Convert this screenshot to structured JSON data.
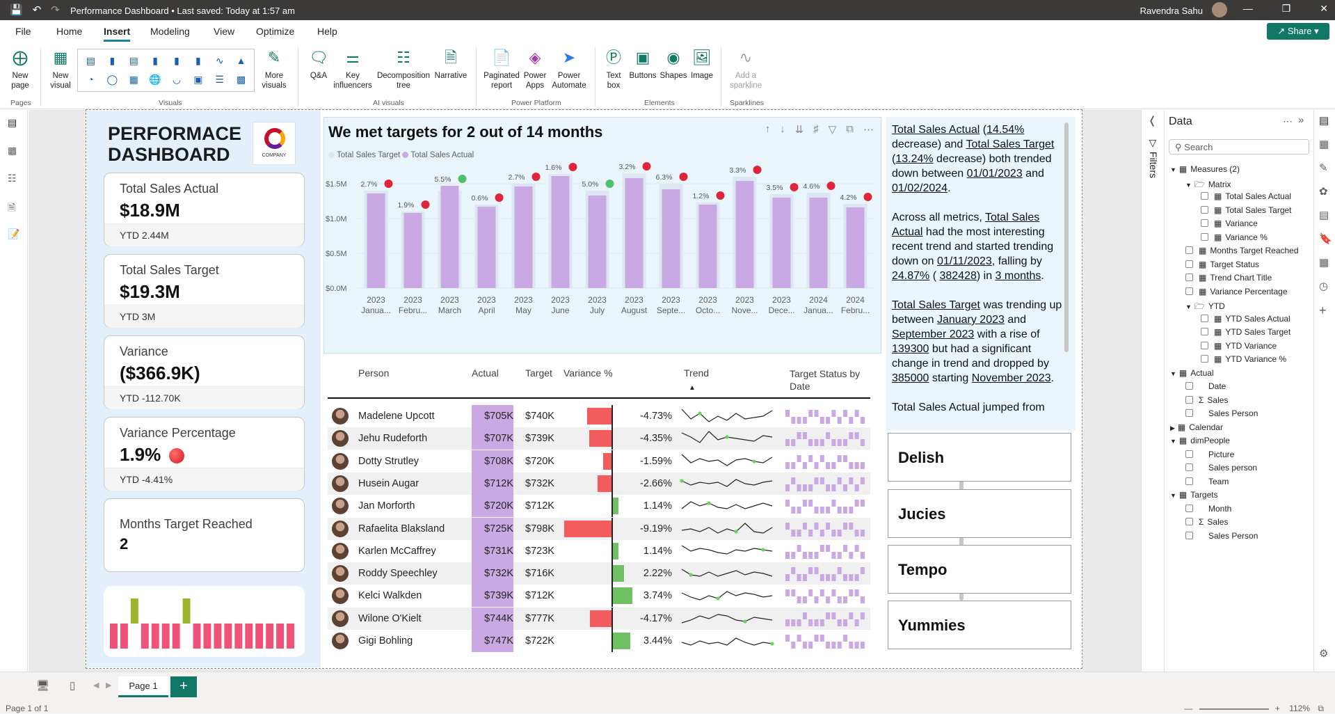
{
  "titlebar": {
    "doc_title": "Performance Dashboard • Last saved: Today at 1:57 am",
    "user": "Ravendra Sahu"
  },
  "menu": {
    "tabs": [
      "File",
      "Home",
      "Insert",
      "Modeling",
      "View",
      "Optimize",
      "Help"
    ],
    "active": "Insert",
    "share": "Share"
  },
  "ribbon": {
    "new_page": "New page",
    "new_visual": "New visual",
    "more_visuals": "More visuals",
    "qa": "Q&A",
    "key_influencers": "Key influencers",
    "decomposition": "Decomposition tree",
    "narrative": "Narrative",
    "paginated": "Paginated report",
    "power_apps": "Power Apps",
    "power_automate": "Power Automate",
    "text_box": "Text box",
    "buttons": "Buttons",
    "shapes": "Shapes",
    "image": "Image",
    "sparkline": "Add a sparkline",
    "groups": {
      "pages": "Pages",
      "visuals": "Visuals",
      "ai": "AI visuals",
      "power_platform": "Power Platform",
      "elements": "Elements",
      "sparklines": "Sparklines"
    }
  },
  "dashboard": {
    "title_line1": "PERFORMACE",
    "title_line2": "DASHBOARD",
    "logo_text": "COMPANY",
    "cards": [
      {
        "title": "Total Sales Actual",
        "value": "$18.9M",
        "ytd": "YTD 2.44M"
      },
      {
        "title": "Total Sales Target",
        "value": "$19.3M",
        "ytd": "YTD 3M"
      },
      {
        "title": "Variance",
        "value": "($366.9K)",
        "ytd": "YTD -112.70K"
      },
      {
        "title": "Variance Percentage",
        "value": "1.9%",
        "ytd": "YTD -4.41%"
      },
      {
        "title": "Months Target Reached",
        "value": "2",
        "ytd": ""
      }
    ],
    "mini_chart_pattern": [
      0,
      0,
      1,
      0,
      0,
      0,
      0,
      1,
      0,
      0,
      0,
      0,
      0,
      0,
      0,
      0,
      0,
      0
    ],
    "colors": {
      "red": "#f0527a",
      "green": "#9ab52a"
    }
  },
  "chart_data": {
    "type": "bar",
    "title": "We met targets for 2 out of 14 months",
    "legend": [
      "Total Sales Target",
      "Total Sales Actual"
    ],
    "categories": [
      "2023 Janua...",
      "2023 Febru...",
      "2023 March",
      "2023 April",
      "2023 May",
      "2023 June",
      "2023 July",
      "2023 August",
      "2023 Septe...",
      "2023 Octo...",
      "2023 Nove...",
      "2023 Dece...",
      "2024 Janua...",
      "2024 Febru..."
    ],
    "cat_year": [
      "2023",
      "2023",
      "2023",
      "2023",
      "2023",
      "2023",
      "2023",
      "2023",
      "2023",
      "2023",
      "2023",
      "2023",
      "2024",
      "2024"
    ],
    "cat_month": [
      "Janua...",
      "Febru...",
      "March",
      "April",
      "May",
      "June",
      "July",
      "August",
      "Septe...",
      "Octo...",
      "Nove...",
      "Dece...",
      "Janua...",
      "Febru..."
    ],
    "series": [
      {
        "name": "Total Sales Target",
        "values": [
          1.4,
          1.1,
          1.4,
          1.2,
          1.5,
          1.64,
          1.4,
          1.65,
          1.5,
          1.23,
          1.6,
          1.35,
          1.37,
          1.21
        ]
      },
      {
        "name": "Total Sales Actual",
        "values": [
          1.36,
          1.08,
          1.47,
          1.17,
          1.46,
          1.61,
          1.33,
          1.58,
          1.42,
          1.2,
          1.54,
          1.3,
          1.3,
          1.16
        ]
      }
    ],
    "labels": [
      "2.7%",
      "1.9%",
      "5.5%",
      "0.6%",
      "2.7%",
      "1.6%",
      "5.0%",
      "3.2%",
      "6.3%",
      "1.2%",
      "3.3%",
      "3.5%",
      "4.6%",
      "4.2%"
    ],
    "status": [
      "red",
      "red",
      "green",
      "red",
      "red",
      "red",
      "green",
      "red",
      "red",
      "red",
      "red",
      "red",
      "red",
      "red"
    ],
    "yticks": [
      "$0.0M",
      "$0.5M",
      "$1.0M",
      "$1.5M"
    ],
    "ylim": [
      0,
      1.75
    ]
  },
  "table": {
    "headers": {
      "person": "Person",
      "actual": "Actual",
      "target": "Target",
      "variance": "Variance %",
      "trend": "Trend",
      "status": "Target Status by Date"
    },
    "rows": [
      {
        "person": "Madelene Upcott",
        "actual": "$705K",
        "target": "$740K",
        "variance": "-4.73%",
        "v": -4.73
      },
      {
        "person": "Jehu Rudeforth",
        "actual": "$707K",
        "target": "$739K",
        "variance": "-4.35%",
        "v": -4.35
      },
      {
        "person": "Dotty Strutley",
        "actual": "$708K",
        "target": "$720K",
        "variance": "-1.59%",
        "v": -1.59
      },
      {
        "person": "Husein Augar",
        "actual": "$712K",
        "target": "$732K",
        "variance": "-2.66%",
        "v": -2.66
      },
      {
        "person": "Jan Morforth",
        "actual": "$720K",
        "target": "$712K",
        "variance": "1.14%",
        "v": 1.14
      },
      {
        "person": "Rafaelita Blaksland",
        "actual": "$725K",
        "target": "$798K",
        "variance": "-9.19%",
        "v": -9.19
      },
      {
        "person": "Karlen McCaffrey",
        "actual": "$731K",
        "target": "$723K",
        "variance": "1.14%",
        "v": 1.14
      },
      {
        "person": "Roddy Speechley",
        "actual": "$732K",
        "target": "$716K",
        "variance": "2.22%",
        "v": 2.22
      },
      {
        "person": "Kelci Walkden",
        "actual": "$739K",
        "target": "$712K",
        "variance": "3.74%",
        "v": 3.74
      },
      {
        "person": "Wilone O'Kielt",
        "actual": "$744K",
        "target": "$777K",
        "variance": "-4.17%",
        "v": -4.17
      },
      {
        "person": "Gigi Bohling",
        "actual": "$747K",
        "target": "$722K",
        "variance": "3.44%",
        "v": 3.44
      }
    ]
  },
  "narrative": {
    "p1": [
      "Total Sales Actual",
      " (",
      "14.54%",
      " decrease) and ",
      "Total Sales Target",
      " (",
      "13.24%",
      " decrease) both trended down between ",
      "01/01/2023",
      " and ",
      "01/02/2024",
      "."
    ],
    "p2": [
      "Across all metrics, ",
      "Total Sales Actual",
      " had the most interesting recent trend and started trending down on ",
      "01/11/2023",
      ", falling by ",
      "24.87%",
      " ( ",
      "382428",
      ") in ",
      "3 months",
      "."
    ],
    "p3": [
      "Total Sales Target",
      " was trending up between ",
      "January 2023",
      " and ",
      "September 2023",
      " with a rise of ",
      "139300",
      " but had a significant change in trend and dropped by ",
      "385000",
      " starting ",
      "November 2023",
      "."
    ],
    "p4": "Total Sales Actual jumped from"
  },
  "slicers": [
    "Delish",
    "Jucies",
    "Tempo",
    "Yummies"
  ],
  "filters": {
    "label": "Filters"
  },
  "data_pane": {
    "title": "Data",
    "search_placeholder": "Search",
    "items": [
      {
        "t": "Measures (2)",
        "lvl": 0,
        "k": "table"
      },
      {
        "t": "Matrix",
        "lvl": 1,
        "k": "folder"
      },
      {
        "t": "Total Sales Actual",
        "lvl": 2,
        "k": "measure"
      },
      {
        "t": "Total Sales Target",
        "lvl": 2,
        "k": "measure"
      },
      {
        "t": "Variance",
        "lvl": 2,
        "k": "measure"
      },
      {
        "t": "Variance %",
        "lvl": 2,
        "k": "measure"
      },
      {
        "t": "Months Target Reached",
        "lvl": 1,
        "k": "measure"
      },
      {
        "t": "Target Status",
        "lvl": 1,
        "k": "measure"
      },
      {
        "t": "Trend Chart Title",
        "lvl": 1,
        "k": "measure"
      },
      {
        "t": "Variance Percentage",
        "lvl": 1,
        "k": "measure"
      },
      {
        "t": "YTD",
        "lvl": 1,
        "k": "folder"
      },
      {
        "t": "YTD Sales Actual",
        "lvl": 2,
        "k": "measure"
      },
      {
        "t": "YTD Sales Target",
        "lvl": 2,
        "k": "measure"
      },
      {
        "t": "YTD Variance",
        "lvl": 2,
        "k": "measure"
      },
      {
        "t": "YTD Variance %",
        "lvl": 2,
        "k": "measure"
      },
      {
        "t": "Actual",
        "lvl": 0,
        "k": "table"
      },
      {
        "t": "Date",
        "lvl": 1,
        "k": "field"
      },
      {
        "t": "Sales",
        "lvl": 1,
        "k": "sum"
      },
      {
        "t": "Sales Person",
        "lvl": 1,
        "k": "field"
      },
      {
        "t": "Calendar",
        "lvl": 0,
        "k": "table-collapsed"
      },
      {
        "t": "dimPeople",
        "lvl": 0,
        "k": "table"
      },
      {
        "t": "Picture",
        "lvl": 1,
        "k": "field"
      },
      {
        "t": "Sales person",
        "lvl": 1,
        "k": "field"
      },
      {
        "t": "Team",
        "lvl": 1,
        "k": "field"
      },
      {
        "t": "Targets",
        "lvl": 0,
        "k": "table"
      },
      {
        "t": "Month",
        "lvl": 1,
        "k": "field"
      },
      {
        "t": "Sales",
        "lvl": 1,
        "k": "sum"
      },
      {
        "t": "Sales Person",
        "lvl": 1,
        "k": "field"
      }
    ]
  },
  "status": {
    "page_tab": "Page 1",
    "page_info": "Page 1 of 1",
    "zoom": "112%"
  }
}
